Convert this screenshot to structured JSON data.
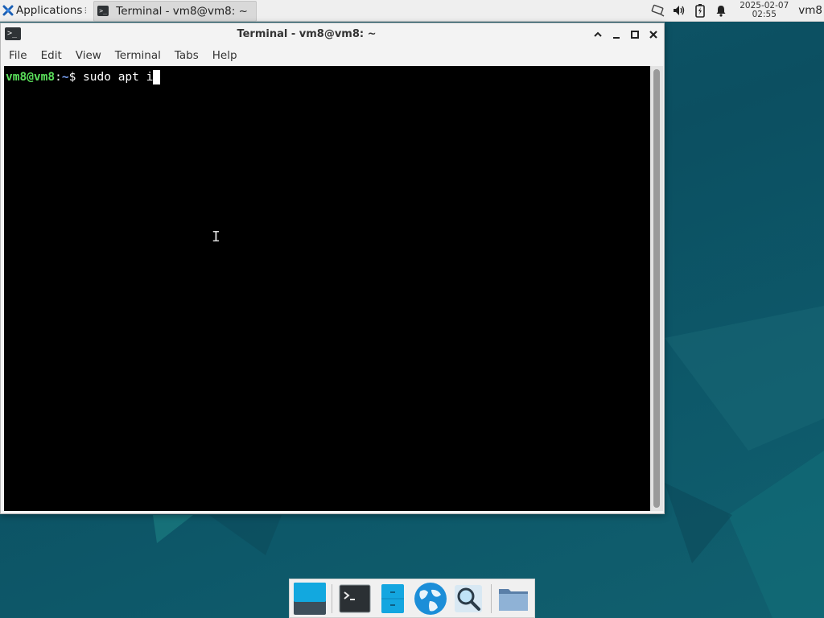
{
  "top_panel": {
    "applications_label": "Applications",
    "task_button_label": "Terminal - vm8@vm8: ~",
    "clock_date": "2025-02-07",
    "clock_time": "02:55",
    "user_label": "vm8",
    "tray_icons": [
      "network-icon",
      "volume-icon",
      "battery-icon",
      "notification-bell-icon"
    ]
  },
  "window": {
    "title": "Terminal - vm8@vm8: ~",
    "controls": [
      "maximize-up-icon",
      "minimize-icon",
      "maximize-icon",
      "close-icon"
    ]
  },
  "menubar": {
    "items": [
      "File",
      "Edit",
      "View",
      "Terminal",
      "Tabs",
      "Help"
    ]
  },
  "terminal": {
    "prompt_user": "vm8@vm8",
    "prompt_colon": ":",
    "prompt_path": "~",
    "prompt_symbol": "$ ",
    "command": "sudo apt i"
  },
  "dock": {
    "items": [
      "show-desktop",
      "terminal",
      "file-manager-drawer",
      "web-browser",
      "app-finder",
      "folder"
    ]
  },
  "colors": {
    "prompt_user": "#5be05b",
    "prompt_path": "#7aa2f7",
    "terminal_bg": "#000000",
    "desktop_bg": "#0f5567"
  }
}
